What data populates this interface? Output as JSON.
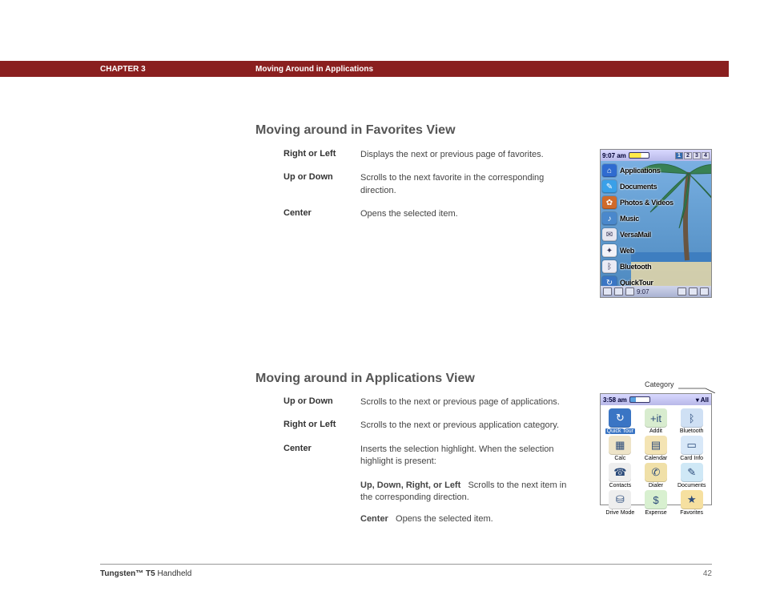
{
  "header": {
    "chapter": "CHAPTER 3",
    "title": "Moving Around in Applications"
  },
  "section1": {
    "title": "Moving around in Favorites View",
    "items": [
      {
        "term": "Right or Left",
        "desc": "Displays the next or previous page of favorites."
      },
      {
        "term": "Up or Down",
        "desc": "Scrolls to the next favorite in the corresponding direction."
      },
      {
        "term": "Center",
        "desc": "Opens the selected item."
      }
    ]
  },
  "section2": {
    "title": "Moving around in Applications View",
    "items": [
      {
        "term": "Up or Down",
        "desc": "Scrolls to the next or previous page of applications."
      },
      {
        "term": "Right or Left",
        "desc": "Scrolls to the next or previous application category."
      },
      {
        "term": "Center",
        "desc": "Inserts the selection highlight. When the selection highlight is present:"
      }
    ],
    "sub": [
      {
        "b": "Up, Down, Right, or Left",
        "t": "Scrolls to the next item in the corresponding direction."
      },
      {
        "b": "Center",
        "t": "Opens the selected item."
      }
    ]
  },
  "fav_screen": {
    "time": "9:07 am",
    "tabs": [
      "1",
      "2",
      "3",
      "4"
    ],
    "items": [
      {
        "label": "Applications",
        "color": "#2f6bd0",
        "glyph": "⌂"
      },
      {
        "label": "Documents",
        "color": "#3aa0e8",
        "glyph": "✎"
      },
      {
        "label": "Photos & Videos",
        "color": "#d06a2a",
        "glyph": "✿"
      },
      {
        "label": "Music",
        "color": "#4a88cc",
        "glyph": "♪"
      },
      {
        "label": "VersaMail",
        "color": "#e6e6f0",
        "glyph": "✉"
      },
      {
        "label": "Web",
        "color": "#f2f2f8",
        "glyph": "✦"
      },
      {
        "label": "Bluetooth",
        "color": "#eaeaf4",
        "glyph": "ᛒ"
      },
      {
        "label": "QuickTour",
        "color": "#3a75c4",
        "glyph": "↻"
      }
    ],
    "bottom_time": "9:07"
  },
  "app_screen": {
    "time": "3:58 am",
    "category_label": "Category",
    "category": "▾ All",
    "apps": [
      {
        "label": "Quick Tour",
        "glyph": "↻",
        "color": "#3a75c4",
        "sel": true
      },
      {
        "label": "Addit",
        "glyph": "+it",
        "color": "#d8eccf"
      },
      {
        "label": "Bluetooth",
        "glyph": "ᛒ",
        "color": "#cfe0f4"
      },
      {
        "label": "Calc",
        "glyph": "▦",
        "color": "#eee4c8"
      },
      {
        "label": "Calendar",
        "glyph": "▤",
        "color": "#f4e4b4"
      },
      {
        "label": "Card Info",
        "glyph": "▭",
        "color": "#d8e8f8"
      },
      {
        "label": "Contacts",
        "glyph": "☎",
        "color": "#eee"
      },
      {
        "label": "Dialer",
        "glyph": "✆",
        "color": "#f0e0a8"
      },
      {
        "label": "Documents",
        "glyph": "✎",
        "color": "#cfe8f6"
      },
      {
        "label": "Drive Mode",
        "glyph": "⛁",
        "color": "#eee"
      },
      {
        "label": "Expense",
        "glyph": "$",
        "color": "#d8f0d0"
      },
      {
        "label": "Favorites",
        "glyph": "★",
        "color": "#f6e0a0"
      }
    ]
  },
  "footer": {
    "product_b": "Tungsten™ T5",
    "product_r": " Handheld",
    "page": "42"
  }
}
